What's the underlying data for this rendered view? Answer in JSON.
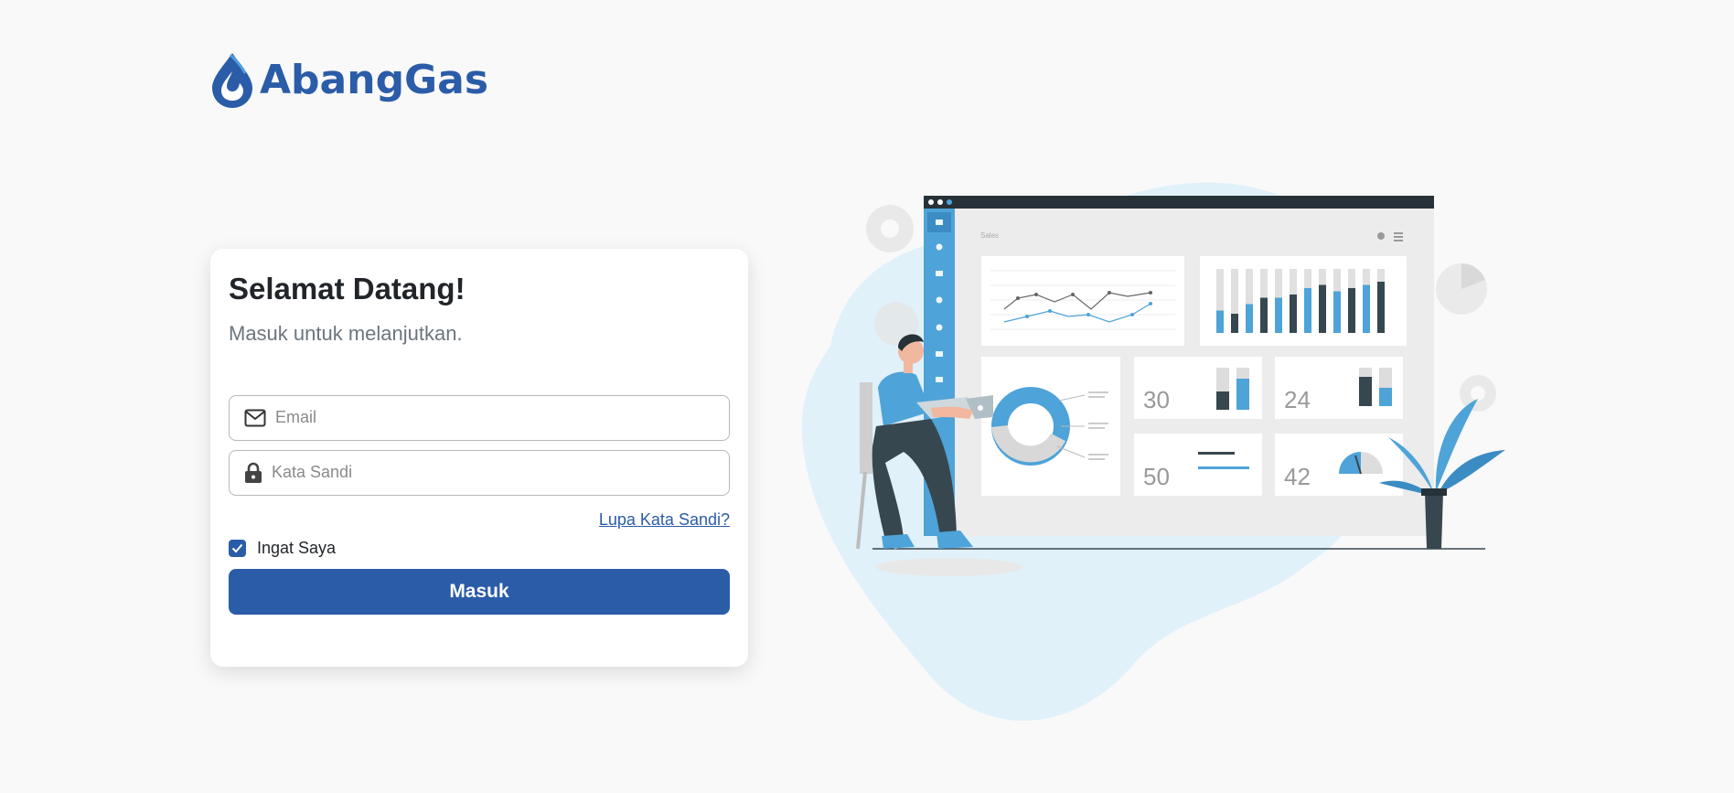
{
  "brand": {
    "name": "AbangGas",
    "color": "#2b5ca8"
  },
  "login": {
    "title": "Selamat Datang!",
    "subtitle": "Masuk untuk melanjutkan.",
    "email": {
      "placeholder": "Email",
      "value": "",
      "icon": "mail-icon"
    },
    "password": {
      "placeholder": "Kata Sandi",
      "value": "",
      "icon": "lock-icon"
    },
    "forgot_label": "Lupa Kata Sandi?",
    "remember_label": "Ingat Saya",
    "remember_checked": true,
    "submit_label": "Masuk"
  },
  "illustration": {
    "dashboard_title": "Sales",
    "card_stats": [
      "30",
      "24",
      "50",
      "42"
    ]
  }
}
